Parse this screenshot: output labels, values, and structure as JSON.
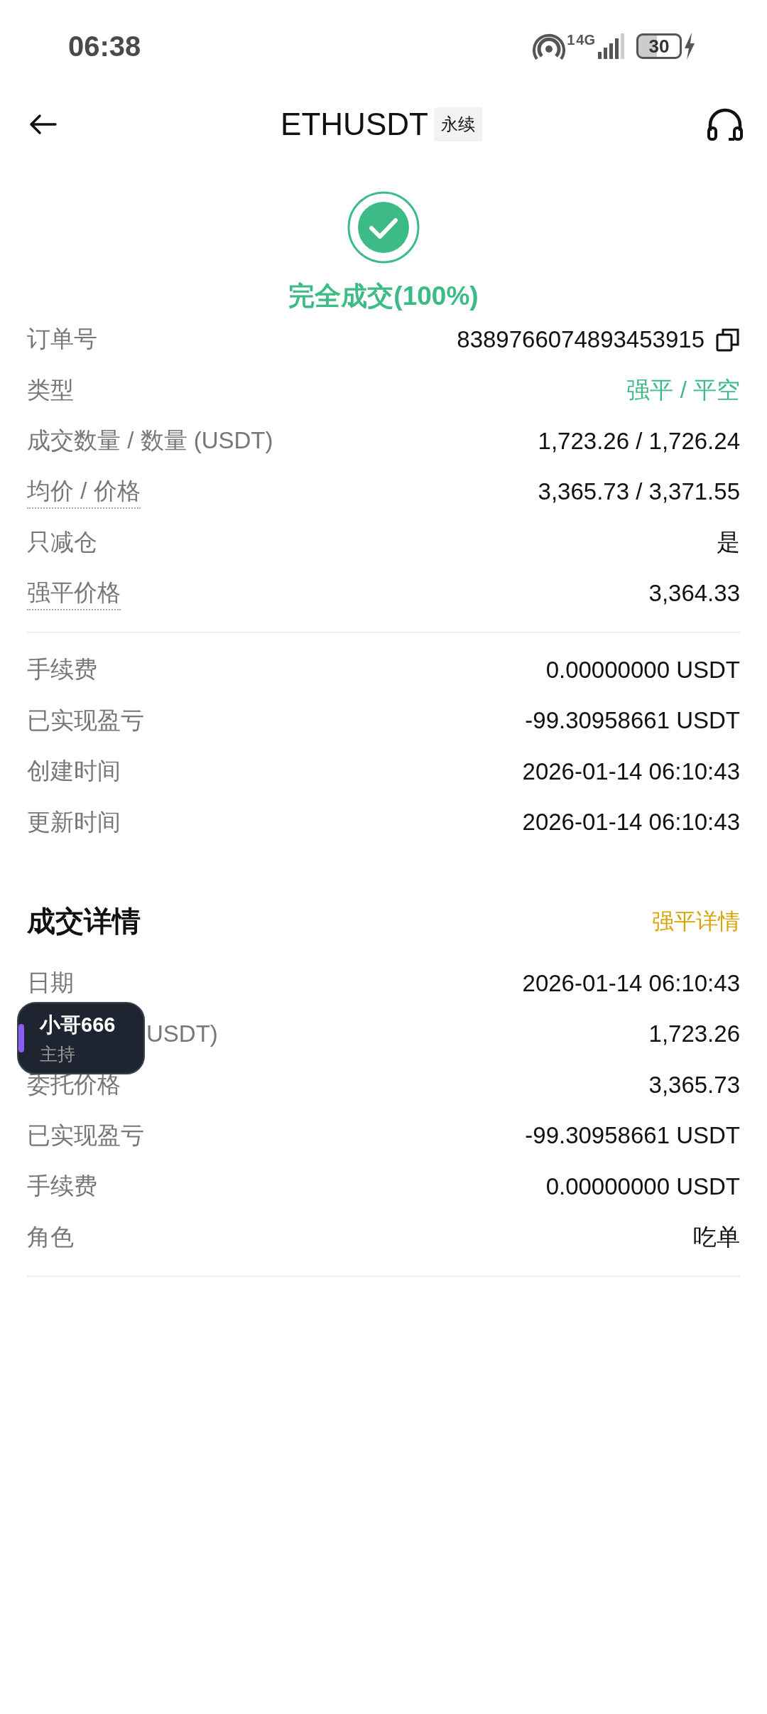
{
  "status_bar": {
    "time": "06:38",
    "sim_slot": "1",
    "network": "4G",
    "battery": "30"
  },
  "header": {
    "title": "ETHUSDT",
    "tag": "永续"
  },
  "result": {
    "status": "完全成交(100%)"
  },
  "order_rows": [
    {
      "label": "订单号",
      "value": "8389766074893453915",
      "kind": "copy"
    },
    {
      "label": "类型",
      "value": "强平 / 平空",
      "kind": "accent"
    },
    {
      "label": "成交数量 / 数量 (USDT)",
      "value": "1,723.26 / 1,726.24",
      "kind": "plain"
    },
    {
      "label": "均价 / 价格",
      "value": "3,365.73 / 3,371.55",
      "kind": "hint"
    },
    {
      "label": "只减仓",
      "value": "是",
      "kind": "plain"
    },
    {
      "label": "强平价格",
      "value": "3,364.33",
      "kind": "hint"
    }
  ],
  "fee_rows": [
    {
      "label": "手续费",
      "value": "0.00000000 USDT"
    },
    {
      "label": "已实现盈亏",
      "value": "-99.30958661 USDT"
    },
    {
      "label": "创建时间",
      "value": "2026-01-14 06:10:43"
    },
    {
      "label": "更新时间",
      "value": "2026-01-14 06:10:43"
    }
  ],
  "trade_details": {
    "title": "成交详情",
    "link": "强平详情",
    "rows": [
      {
        "label": "日期",
        "value": "2026-01-14 06:10:43",
        "kind": "plain"
      },
      {
        "label": "USDT)",
        "value": "1,723.26",
        "kind": "covered"
      },
      {
        "label": "委托价格",
        "value": "3,365.73",
        "kind": "plain"
      },
      {
        "label": "已实现盈亏",
        "value": "-99.30958661 USDT",
        "kind": "plain"
      },
      {
        "label": "手续费",
        "value": "0.00000000 USDT",
        "kind": "plain"
      },
      {
        "label": "角色",
        "value": "吃单",
        "kind": "plain"
      }
    ]
  },
  "floating_badge": {
    "name": "小哥666",
    "role": "主持",
    "color": "#8b5cf6"
  }
}
